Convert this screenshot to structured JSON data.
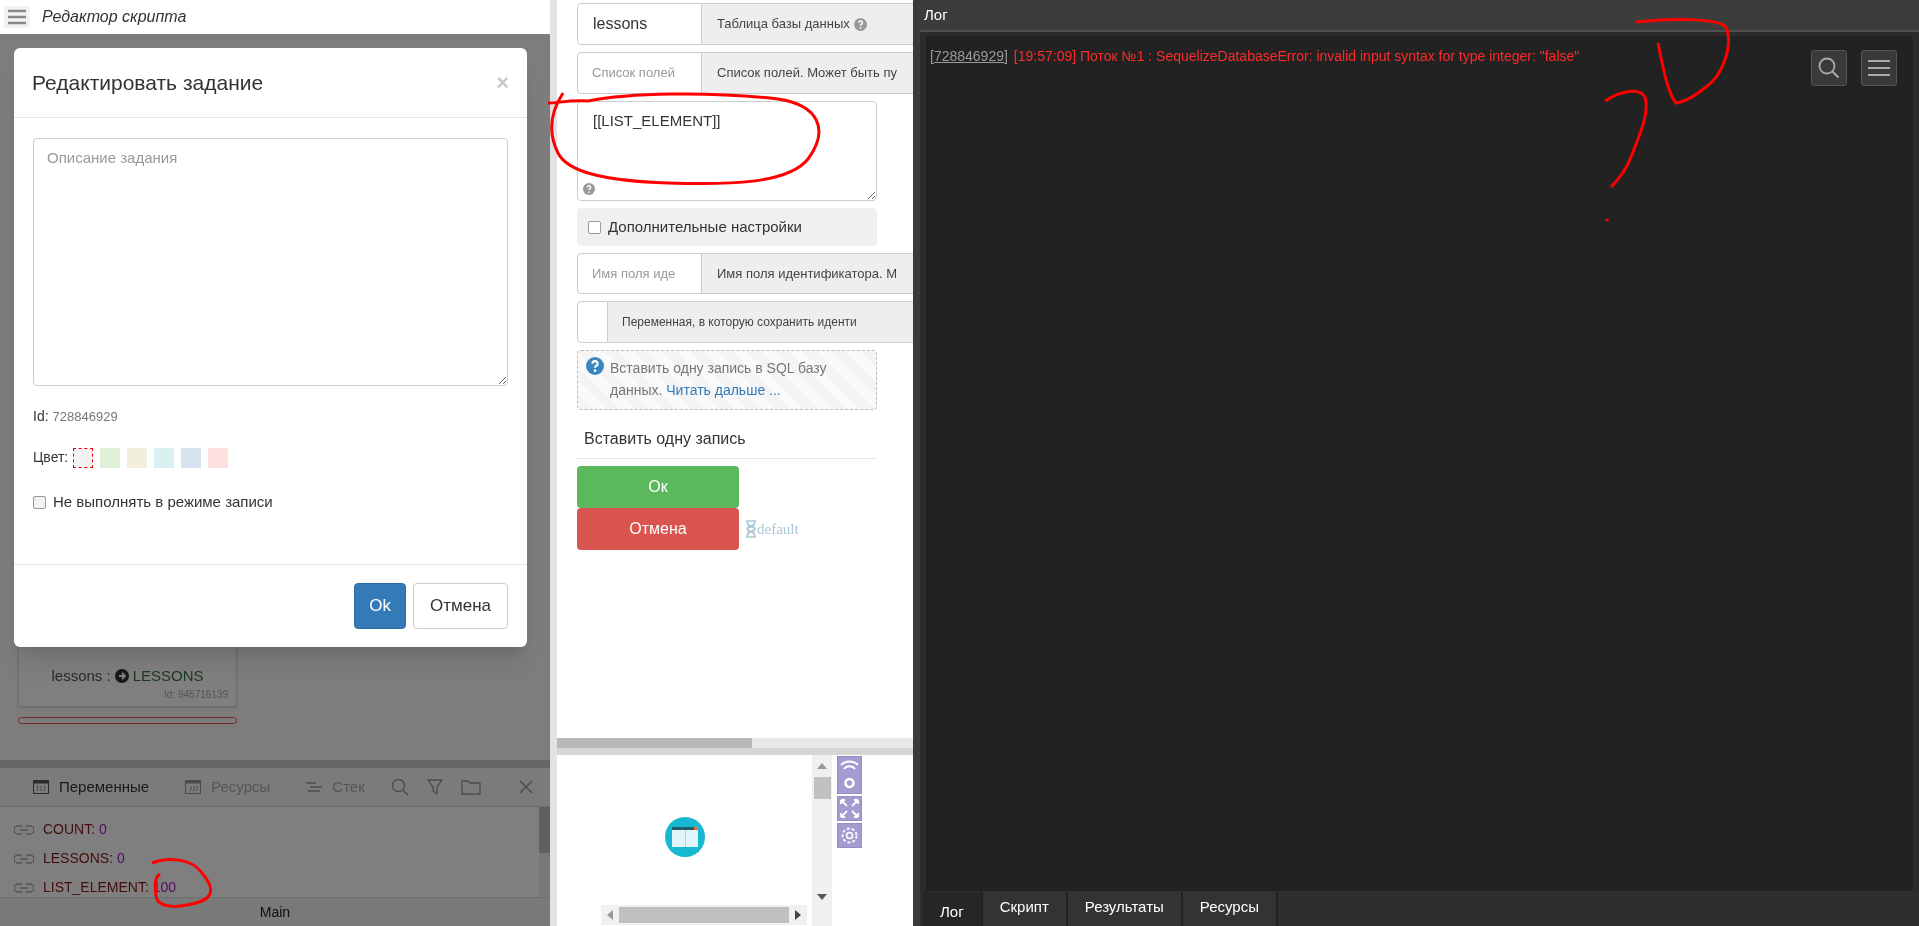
{
  "editor": {
    "title": "Редактор скрипта"
  },
  "node_card": {
    "input": "lessons :",
    "output": "LESSONS",
    "id": "Id: 945716139"
  },
  "bottom_panel": {
    "tabs": [
      {
        "label": "Переменные",
        "kind": "variables",
        "selected": true
      },
      {
        "label": "Ресурсы",
        "kind": "resources",
        "selected": false
      },
      {
        "label": "Стек",
        "kind": "stack",
        "selected": false
      }
    ],
    "variables": [
      {
        "name": "COUNT:",
        "value": "0"
      },
      {
        "name": "LESSONS:",
        "value": "0"
      },
      {
        "name": "LIST_ELEMENT:",
        "value": "100"
      }
    ],
    "footer": "Main"
  },
  "modal": {
    "title": "Редактировать задание",
    "close": "×",
    "description_placeholder": "Описание задания",
    "id_label": "Id:",
    "id_value": "728846929",
    "color_label": "Цвет:",
    "colors": [
      {
        "color": "#f2f2f2",
        "selected": true
      },
      {
        "color": "#dff0d8",
        "selected": false
      },
      {
        "color": "#f2efdc",
        "selected": false
      },
      {
        "color": "#d9f0f0",
        "selected": false
      },
      {
        "color": "#d9e3ef",
        "selected": false
      },
      {
        "color": "#fde0e0",
        "selected": false
      }
    ],
    "skip_in_record": {
      "label": "Не выполнять в режиме записи",
      "checked": false
    },
    "buttons": [
      {
        "label": "Ok",
        "kind": "primary"
      },
      {
        "label": "Отмена",
        "kind": "default"
      }
    ]
  },
  "form": {
    "table": {
      "value": "lessons",
      "addon": "Таблица базы данных"
    },
    "fields": {
      "placeholder": "Список полей",
      "addon": "Список полей. Может быть пу"
    },
    "fields_value": "[[LIST_ELEMENT]]",
    "advanced": {
      "label": "Дополнительные настройки",
      "checked": false
    },
    "id_field": {
      "placeholder": "Имя поля иде",
      "addon": "Имя поля идентификатора. М"
    },
    "id_variable": {
      "addon": "Переменная, в которую сохранить иденти"
    },
    "info": {
      "text": "Вставить одну запись в SQL базу данных. ",
      "link": "Читать дальше ..."
    },
    "title": "Вставить одну запись",
    "buttons": [
      {
        "label": "Ок",
        "kind": "success"
      },
      {
        "label": "Отмена",
        "kind": "danger"
      }
    ],
    "timeout": "default"
  },
  "log": {
    "title": "Лог",
    "entries": [
      {
        "id": "[728846929]",
        "message": "[19:57:09] Поток №1 : SequelizeDatabaseError: invalid input syntax for type integer: \"false\""
      }
    ],
    "tabs": [
      {
        "label": "Лог",
        "selected": true
      },
      {
        "label": "Скрипт",
        "selected": false
      },
      {
        "label": "Результаты",
        "selected": false
      },
      {
        "label": "Ресурсы",
        "selected": false
      }
    ]
  }
}
